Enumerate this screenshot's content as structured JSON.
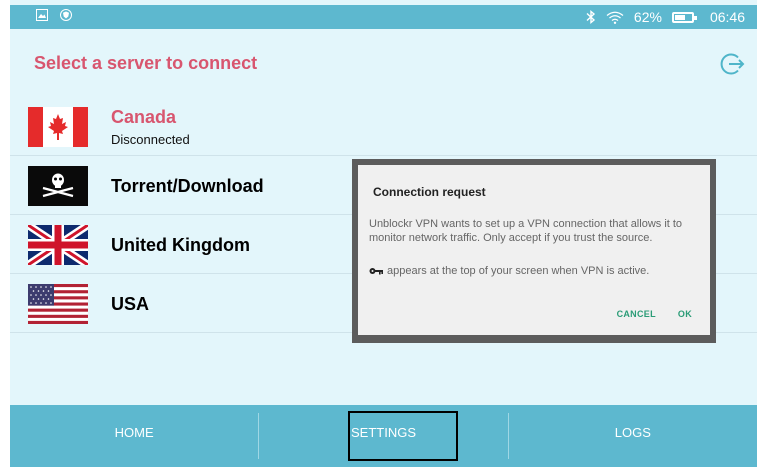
{
  "status_bar": {
    "battery": "62%",
    "battery_level": 0.62,
    "time": "06:46",
    "icons": [
      "gallery-icon",
      "shield-icon",
      "bluetooth-icon",
      "wifi-icon",
      "battery-icon"
    ]
  },
  "header": {
    "title": "Select a server to connect",
    "action_icon": "logout-icon"
  },
  "servers": [
    {
      "name": "Canada",
      "status": "Disconnected",
      "flag": "canada-flag-icon"
    },
    {
      "name": "Torrent/Download",
      "flag": "pirate-flag-icon"
    },
    {
      "name": "United Kingdom",
      "flag": "uk-flag-icon"
    },
    {
      "name": "USA",
      "flag": "usa-flag-icon"
    }
  ],
  "tabs": [
    {
      "label": "HOME"
    },
    {
      "label": "SETTINGS",
      "focused": true
    },
    {
      "label": "LOGS"
    }
  ],
  "dialog": {
    "title": "Connection request",
    "body": "Unblockr VPN wants to set up a VPN connection that allows it to monitor network traffic. Only accept if you trust the source.",
    "note": "appears at the top of your screen when VPN is active.",
    "note_icon": "key-icon",
    "cancel_label": "CANCEL",
    "ok_label": "OK"
  },
  "colors": {
    "accent": "#5db8cf",
    "title": "#d8566f",
    "background": "#e3f6fb",
    "dialog_button": "#2b9c77"
  }
}
